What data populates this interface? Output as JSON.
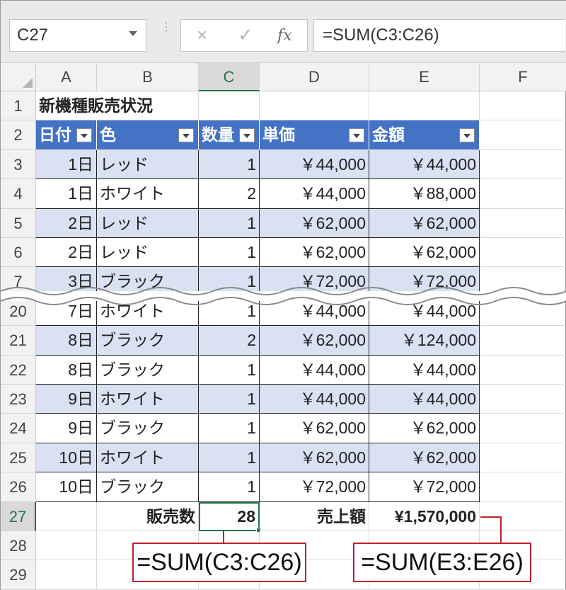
{
  "formula_bar": {
    "name_box": "C27",
    "cancel_icon": "×",
    "enter_icon": "✓",
    "fx_icon": "fx",
    "formula": "=SUM(C3:C26)"
  },
  "columns": [
    "A",
    "B",
    "C",
    "D",
    "E",
    "F"
  ],
  "title": "新機種販売状況",
  "table_headers": [
    "日付",
    "色",
    "数量",
    "単価",
    "金額"
  ],
  "rows": [
    {
      "row": "3",
      "date": "1日",
      "color": "レッド",
      "qty": "1",
      "price": "￥44,000",
      "amount": "￥44,000"
    },
    {
      "row": "4",
      "date": "1日",
      "color": "ホワイト",
      "qty": "2",
      "price": "￥44,000",
      "amount": "￥88,000"
    },
    {
      "row": "5",
      "date": "2日",
      "color": "レッド",
      "qty": "1",
      "price": "￥62,000",
      "amount": "￥62,000"
    },
    {
      "row": "6",
      "date": "2日",
      "color": "レッド",
      "qty": "1",
      "price": "￥62,000",
      "amount": "￥62,000"
    },
    {
      "row": "7",
      "date": "3日",
      "color": "ブラック",
      "qty": "1",
      "price": "￥72,000",
      "amount": "￥72,000"
    },
    {
      "row": "20",
      "date": "7日",
      "color": "ホワイト",
      "qty": "1",
      "price": "￥44,000",
      "amount": "￥44,000"
    },
    {
      "row": "21",
      "date": "8日",
      "color": "ブラック",
      "qty": "2",
      "price": "￥62,000",
      "amount": "￥124,000"
    },
    {
      "row": "22",
      "date": "8日",
      "color": "ブラック",
      "qty": "1",
      "price": "￥44,000",
      "amount": "￥44,000"
    },
    {
      "row": "23",
      "date": "9日",
      "color": "ホワイト",
      "qty": "1",
      "price": "￥44,000",
      "amount": "￥44,000"
    },
    {
      "row": "24",
      "date": "9日",
      "color": "ブラック",
      "qty": "1",
      "price": "￥62,000",
      "amount": "￥62,000"
    },
    {
      "row": "25",
      "date": "10日",
      "color": "ホワイト",
      "qty": "1",
      "price": "￥62,000",
      "amount": "￥62,000"
    },
    {
      "row": "26",
      "date": "10日",
      "color": "ブラック",
      "qty": "1",
      "price": "￥72,000",
      "amount": "￥72,000"
    }
  ],
  "summary": {
    "qty_label": "販売数",
    "qty_total": "28",
    "amount_label": "売上額",
    "amount_total": "¥1,570,000"
  },
  "row_numbers": [
    "1",
    "2",
    "27",
    "28",
    "29"
  ],
  "callouts": {
    "qty_formula": "=SUM(C3:C26)",
    "amount_formula": "=SUM(E3:E26)"
  },
  "colors": {
    "header_fill": "#4472c4",
    "band_fill": "#d9e1f2",
    "selection": "#217346",
    "callout_border": "#c0202c"
  }
}
